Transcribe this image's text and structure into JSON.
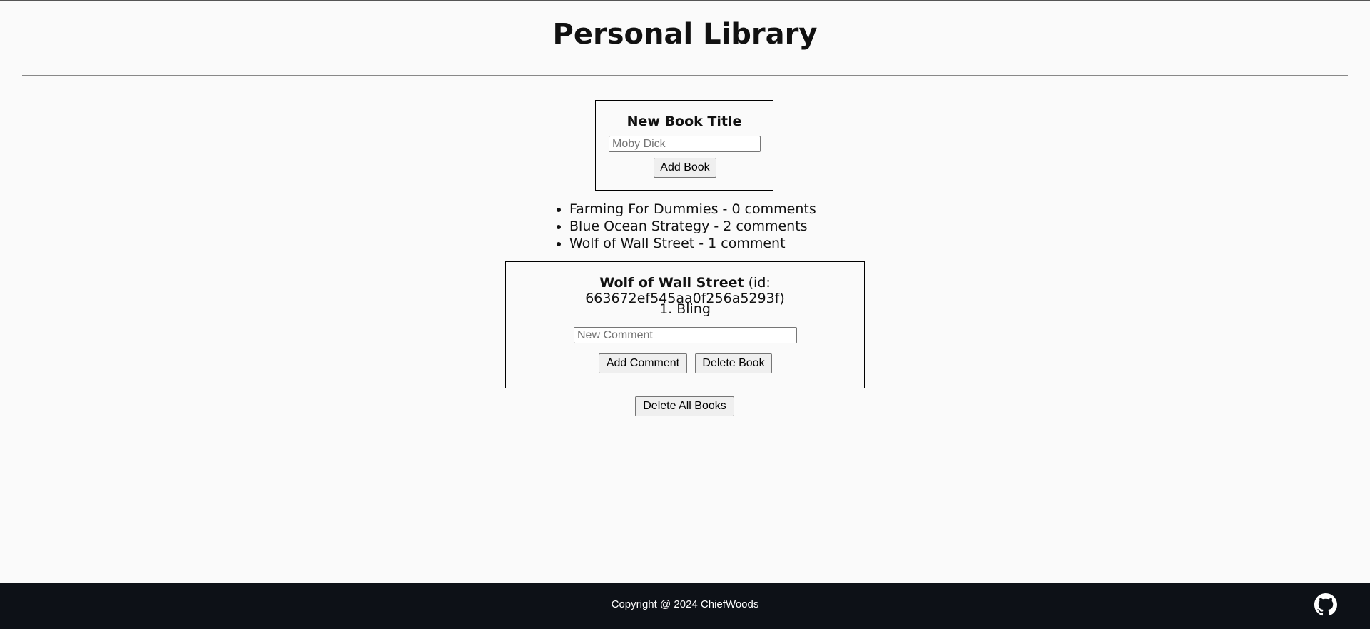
{
  "header": {
    "title": "Personal Library"
  },
  "new_book": {
    "label": "New Book Title",
    "input_value": "",
    "input_placeholder": "Moby Dick",
    "add_button": "Add Book"
  },
  "books": [
    {
      "title": "Farming For Dummies",
      "comments": "0 comments",
      "text": "Farming For Dummies - 0 comments"
    },
    {
      "title": "Blue Ocean Strategy",
      "comments": "2 comments",
      "text": "Blue Ocean Strategy - 2 comments"
    },
    {
      "title": "Wolf of Wall Street",
      "comments": "1 comment",
      "text": "Wolf of Wall Street - 1 comment"
    }
  ],
  "selected_book": {
    "title": "Wolf of Wall Street",
    "id_text": " (id: 663672ef545aa0f256a5293f)",
    "comments": [
      "1. Bling"
    ],
    "comment_input_value": "",
    "comment_placeholder": "New Comment",
    "add_comment_button": "Add Comment",
    "delete_book_button": "Delete Book"
  },
  "delete_all_button": "Delete All Books",
  "footer": {
    "copyright": "Copyright @ 2024 ChiefWoods",
    "github_icon": "github-icon"
  },
  "colors": {
    "background": "#fafafa",
    "footer_background": "#0d1117",
    "footer_text": "#ffffff",
    "button_background": "#efefef"
  }
}
